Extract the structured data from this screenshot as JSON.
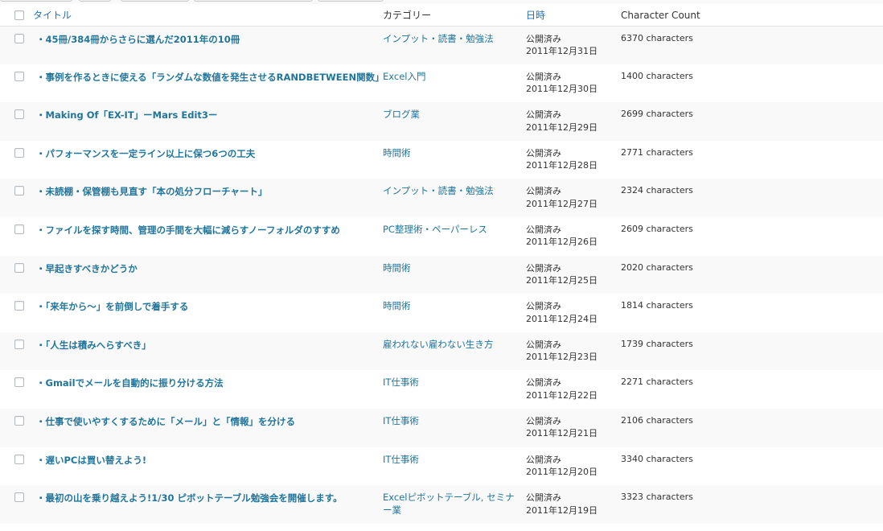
{
  "columns": {
    "title": "タイトル",
    "category": "カテゴリー",
    "date": "日時",
    "count": "Character Count"
  },
  "colors": {
    "link": "#21759b",
    "sortable_header": "#2270b6",
    "row_alt": "#f9f9f9"
  },
  "posts": [
    {
      "title": "・45冊/384冊からさらに選んだ2011年の10冊",
      "category": "インプット・読書・勉強法",
      "status": "公開済み",
      "date": "2011年12月31日",
      "count": "6370 characters"
    },
    {
      "title": "・事例を作るときに使える「ランダムな数値を発生させるRANDBETWEEN関数」",
      "category": "Excel入門",
      "status": "公開済み",
      "date": "2011年12月30日",
      "count": "1400 characters"
    },
    {
      "title": "・Making Of「EX-IT」ーMars Edit3ー",
      "category": "ブログ業",
      "status": "公開済み",
      "date": "2011年12月29日",
      "count": "2699 characters"
    },
    {
      "title": "・パフォーマンスを一定ライン以上に保つ6つの工夫",
      "category": "時間術",
      "status": "公開済み",
      "date": "2011年12月28日",
      "count": "2771 characters"
    },
    {
      "title": "・未読棚・保管棚も見直す「本の処分フローチャート」",
      "category": "インプット・読書・勉強法",
      "status": "公開済み",
      "date": "2011年12月27日",
      "count": "2324 characters"
    },
    {
      "title": "・ファイルを探す時間、管理の手間を大幅に減らすノーフォルダのすすめ",
      "category": "PC整理術・ペーパーレス",
      "status": "公開済み",
      "date": "2011年12月26日",
      "count": "2609 characters"
    },
    {
      "title": "・早起きすべきかどうか",
      "category": "時間術",
      "status": "公開済み",
      "date": "2011年12月25日",
      "count": "2020 characters"
    },
    {
      "title": "・「来年から〜」を前倒しで着手する",
      "category": "時間術",
      "status": "公開済み",
      "date": "2011年12月24日",
      "count": "1814 characters"
    },
    {
      "title": "・「人生は積みへらすべき」",
      "category": "雇われない雇わない生き方",
      "status": "公開済み",
      "date": "2011年12月23日",
      "count": "1739 characters"
    },
    {
      "title": "・Gmailでメールを自動的に振り分ける方法",
      "category": "IT仕事術",
      "status": "公開済み",
      "date": "2011年12月22日",
      "count": "2271 characters"
    },
    {
      "title": "・仕事で使いやすくするために「メール」と「情報」を分ける",
      "category": "IT仕事術",
      "status": "公開済み",
      "date": "2011年12月21日",
      "count": "2106 characters"
    },
    {
      "title": "・遅いPCは買い替えよう!",
      "category": "IT仕事術",
      "status": "公開済み",
      "date": "2011年12月20日",
      "count": "3340 characters"
    },
    {
      "title": "・最初の山を乗り越えよう!1/30 ピボットテーブル勉強会を開催します。",
      "category": "Excelピボットテーブル, セミナー業",
      "status": "公開済み",
      "date": "2011年12月19日",
      "count": "3323 characters"
    }
  ]
}
